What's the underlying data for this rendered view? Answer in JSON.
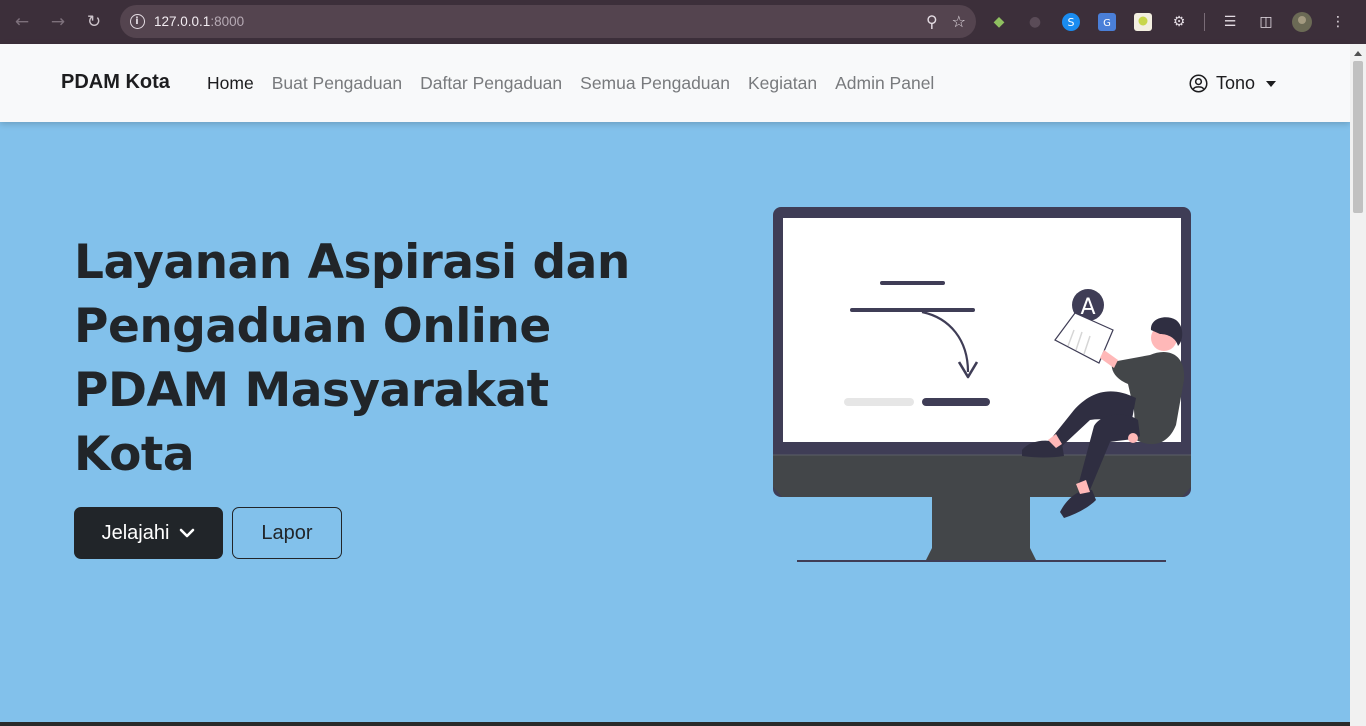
{
  "browser": {
    "url_host": "127.0.0.1",
    "url_port": ":8000"
  },
  "navbar": {
    "brand": "PDAM Kota",
    "links": [
      {
        "label": "Home",
        "active": true
      },
      {
        "label": "Buat Pengaduan",
        "active": false
      },
      {
        "label": "Daftar Pengaduan",
        "active": false
      },
      {
        "label": "Semua Pengaduan",
        "active": false
      },
      {
        "label": "Kegiatan",
        "active": false
      },
      {
        "label": "Admin Panel",
        "active": false
      }
    ],
    "user_name": "Tono"
  },
  "hero": {
    "title_lines": [
      "Layanan Aspirasi dan",
      "Pengaduan Online",
      "PDAM Masyarakat",
      "Kota"
    ],
    "explore_label": "Jelajahi",
    "report_label": "Lapor",
    "illustration_letter": "A"
  },
  "colors": {
    "hero_bg": "#82c1eb",
    "dark": "#212529",
    "navbar_bg": "#f8f9fa"
  }
}
